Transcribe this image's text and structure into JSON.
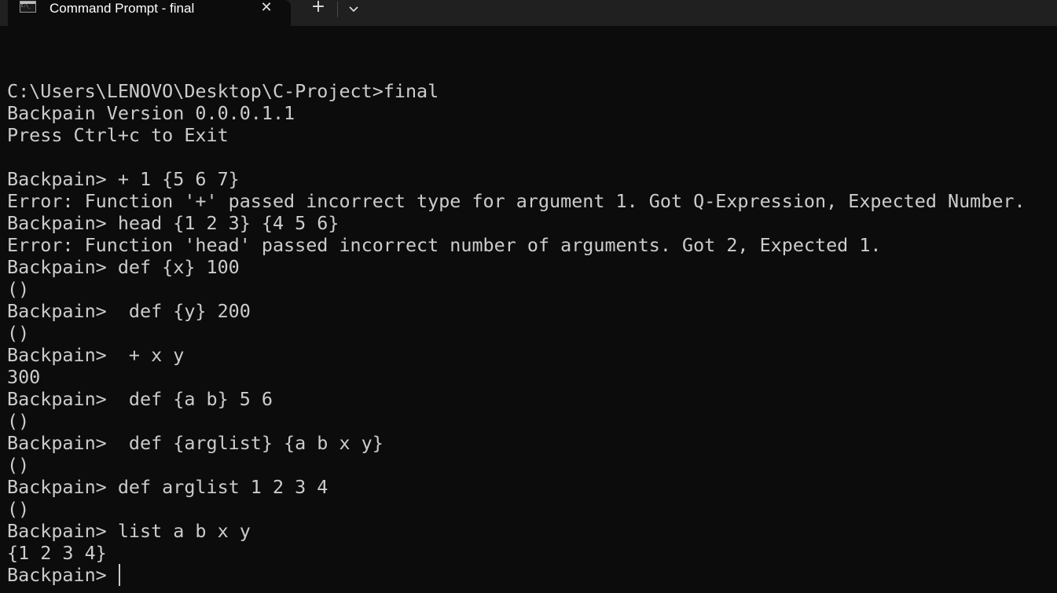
{
  "tab": {
    "title": "Command Prompt - final",
    "close_glyph": "✕"
  },
  "toolbar": {
    "new_tab_glyph": "+"
  },
  "icons": {
    "tab_icon": "terminal-icon",
    "close": "close-icon",
    "new_tab": "plus-icon",
    "dropdown": "chevron-down-icon"
  },
  "colors": {
    "background": "#0c0c0c",
    "titlebar": "#202020",
    "text": "#cccccc"
  },
  "terminal": {
    "lines": [
      "",
      "C:\\Users\\LENOVO\\Desktop\\C-Project>final",
      "Backpain Version 0.0.0.1.1",
      "Press Ctrl+c to Exit",
      "",
      "Backpain> + 1 {5 6 7}",
      "Error: Function '+' passed incorrect type for argument 1. Got Q-Expression, Expected Number.",
      "Backpain> head {1 2 3} {4 5 6}",
      "Error: Function 'head' passed incorrect number of arguments. Got 2, Expected 1.",
      "Backpain> def {x} 100",
      "()",
      "Backpain>  def {y} 200",
      "()",
      "Backpain>  + x y",
      "300",
      "Backpain>  def {a b} 5 6",
      "()",
      "Backpain>  def {arglist} {a b x y}",
      "()",
      "Backpain> def arglist 1 2 3 4",
      "()",
      "Backpain> list a b x y",
      "{1 2 3 4}"
    ],
    "prompt": "Backpain> "
  }
}
